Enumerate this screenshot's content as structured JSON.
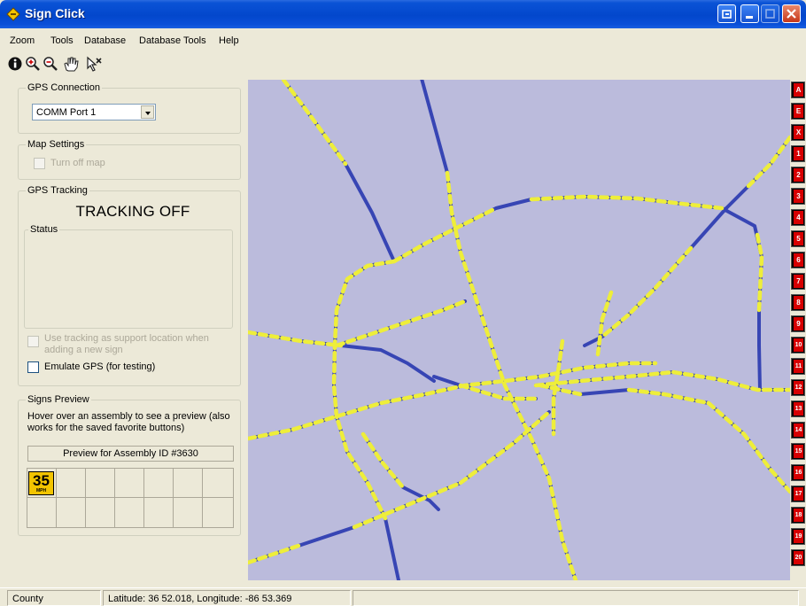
{
  "window": {
    "title": "Sign Click",
    "buttons": [
      "restore-icon",
      "minimize-icon",
      "maximize-icon",
      "close-icon"
    ]
  },
  "menu": [
    "Zoom",
    "Tools",
    "Database",
    "Database Tools",
    "Help"
  ],
  "toolbar": [
    "info-icon",
    "zoom-in-icon",
    "zoom-out-icon",
    "pan-hand-icon",
    "select-pointer-icon"
  ],
  "gps_connection": {
    "legend": "GPS Connection",
    "port_value": "COMM Port 1"
  },
  "map_settings": {
    "legend": "Map Settings",
    "turn_off_map_label": "Turn off map",
    "turn_off_map_checked": false,
    "turn_off_map_disabled": true
  },
  "gps_tracking": {
    "legend": "GPS Tracking",
    "status_text": "TRACKING OFF",
    "status_legend": "Status",
    "use_tracking_label_line1": "Use tracking as support location when",
    "use_tracking_label_line2": "adding a new sign",
    "use_tracking_checked": false,
    "emulate_label": "Emulate GPS (for testing)",
    "emulate_checked": false
  },
  "signs_preview": {
    "legend": "Signs Preview",
    "hint_line1": "Hover over an assembly to see a preview (also",
    "hint_line2": "works for the saved favorite buttons)",
    "preview_label": "Preview for Assembly ID #3630",
    "sign_speed": "35",
    "sign_unit": "MPH"
  },
  "map": {
    "background_color": "#bbbbdc",
    "road_color": "#3745b4",
    "sign_marker_color": "#eeee3a"
  },
  "favorites": [
    "A",
    "E",
    "X",
    "1",
    "2",
    "3",
    "4",
    "5",
    "6",
    "7",
    "8",
    "9",
    "10",
    "11",
    "12",
    "13",
    "14",
    "15",
    "16",
    "17",
    "18",
    "19",
    "20"
  ],
  "statusbar": {
    "layer": "County",
    "coords": "Latitude: 36 52.018, Longitude: -86 53.369",
    "extra": ""
  }
}
